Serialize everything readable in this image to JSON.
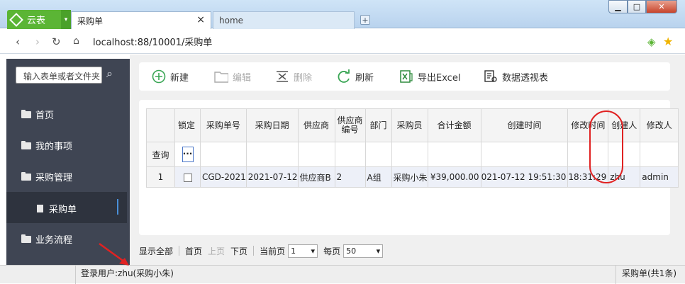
{
  "browser": {
    "app_name": "云表",
    "tabs": [
      {
        "label": "采购单",
        "close": "×"
      },
      {
        "label": "home"
      }
    ],
    "url": "localhost:88/10001/采购单"
  },
  "sidebar": {
    "search_placeholder": "输入表单或者文件夹",
    "items": [
      {
        "label": "首页"
      },
      {
        "label": "我的事项"
      },
      {
        "label": "采购管理"
      },
      {
        "label": "采购单"
      },
      {
        "label": "业务流程"
      }
    ]
  },
  "toolbar": {
    "new": "新建",
    "edit": "编辑",
    "delete": "删除",
    "refresh": "刷新",
    "export": "导出Excel",
    "pivot": "数据透视表"
  },
  "grid": {
    "headers": [
      "锁定",
      "采购单号",
      "采购日期",
      "供应商",
      "供应商编号",
      "部门",
      "采购员",
      "合计金额",
      "创建时间",
      "修改时间",
      "创建人",
      "修改人"
    ],
    "filter_label": "查询",
    "ellipsis": "···",
    "rows": [
      {
        "index": "1",
        "order_no": "CGD-2021",
        "date": "2021-07-12",
        "supplier": "供应商B",
        "supplier_no": "2",
        "dept": "A组",
        "buyer": "采购小朱",
        "total": "¥39,000.00",
        "created": "021-07-12 19:51:30",
        "modified": "18:31:29",
        "creator": "zhu",
        "modifier": "admin"
      }
    ]
  },
  "pager": {
    "show_all": "显示全部",
    "first": "首页",
    "prev": "上页",
    "next": "下页",
    "current_label": "当前页",
    "current_value": "1",
    "per_page_label": "每页",
    "per_page_value": "50"
  },
  "status": {
    "user": "登录用户:zhu(采购小朱)",
    "right": "采购单(共1条)"
  },
  "colors": {
    "accent_green": "#5bb535",
    "sidebar": "#3f4553",
    "highlight": "#e02222"
  }
}
